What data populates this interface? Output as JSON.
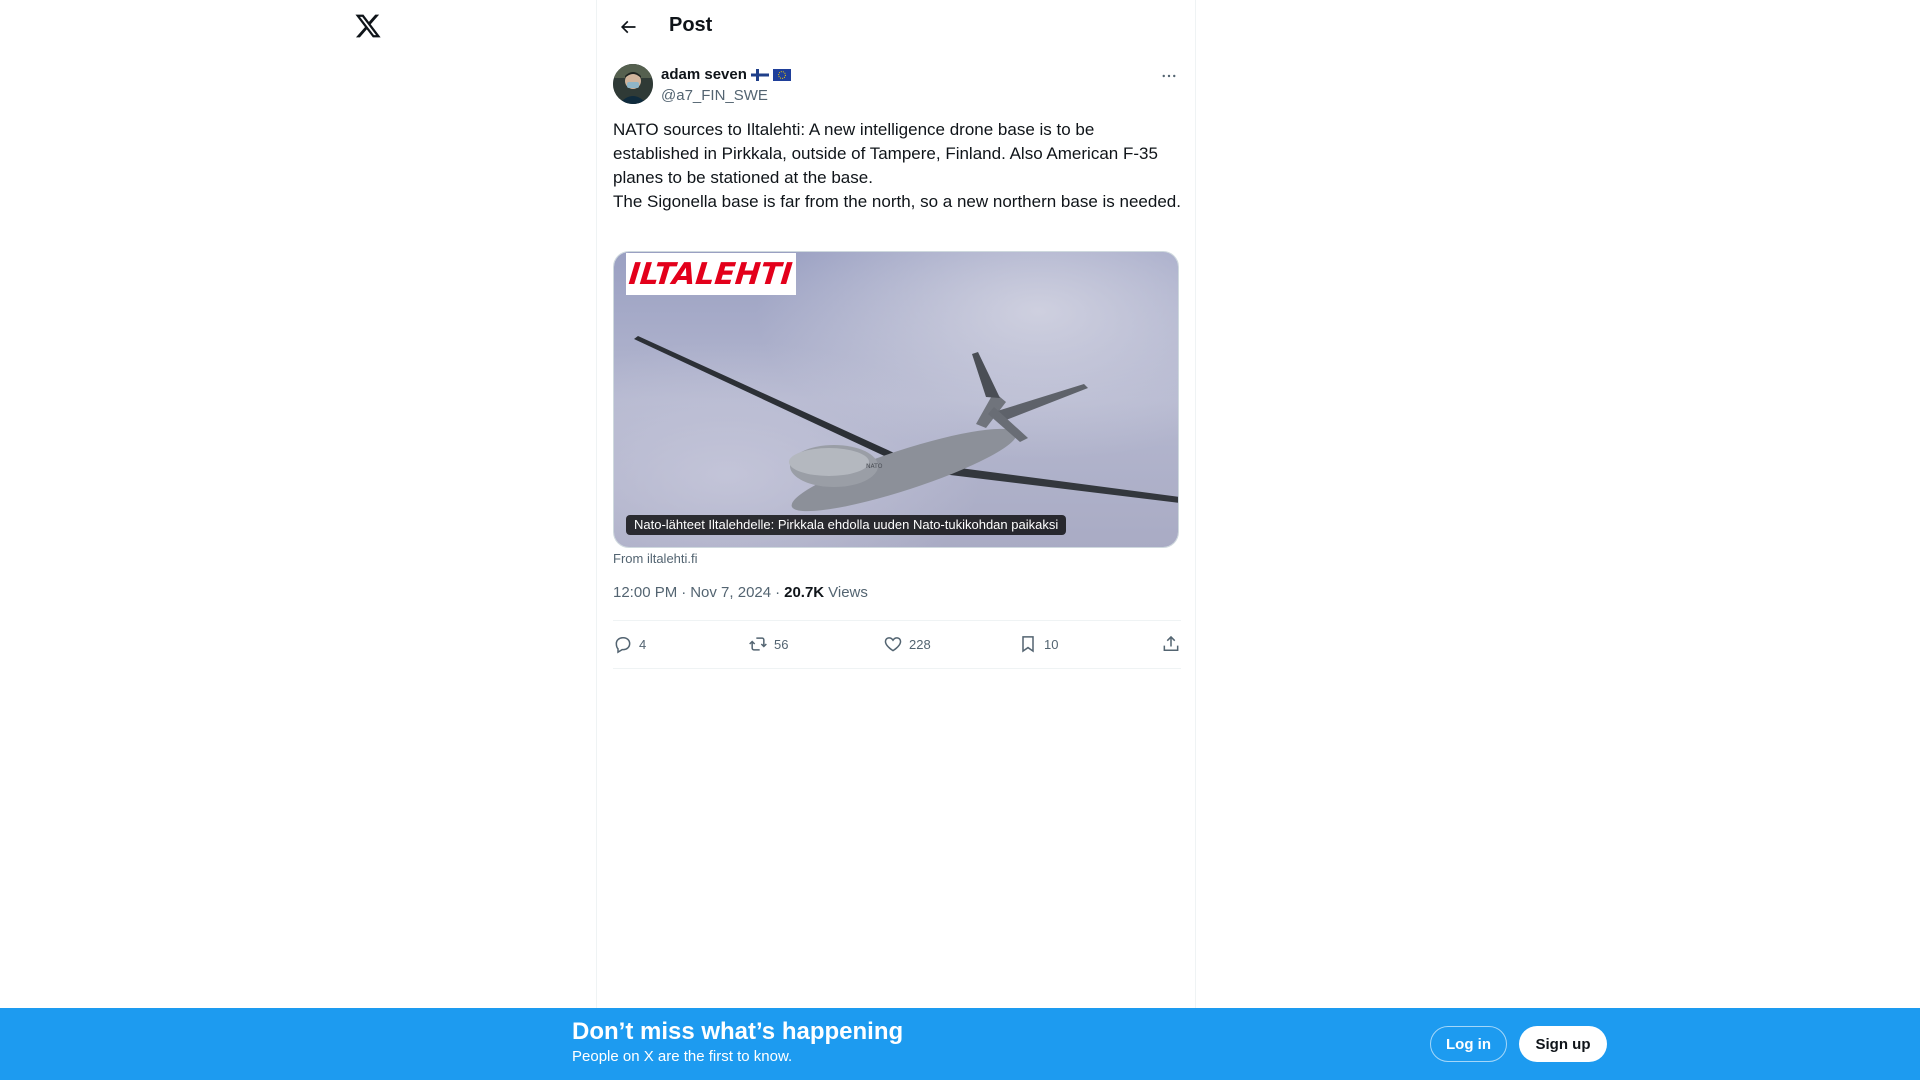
{
  "header": {
    "logo": "x-logo-icon",
    "title": "Post",
    "back_icon": "arrow-left-icon"
  },
  "post": {
    "author_name": "adam seven",
    "author_flags": [
      "finland-flag",
      "eu-flag"
    ],
    "author_handle": "@a7_FIN_SWE",
    "text_lines": [
      "NATO sources to Iltalehti: A new intelligence drone base is to be established in Pirkkala, outside of Tampere, Finland. Also American F-35 planes to be stationed at the base.",
      "The Sigonella base is far from the north, so a new northern base is needed."
    ],
    "card": {
      "logo_text": "ILTALEHTI",
      "caption": "Nato-lähteet Iltalehdelle: Pirkkala ehdolla uuden Nato-tukikohdan paikaksi",
      "source": "From iltalehti.fi"
    },
    "time": "12:00 PM",
    "date": "Nov 7, 2024",
    "views_count": "20.7K",
    "views_label": "Views",
    "separator": "·",
    "stats": {
      "replies": "4",
      "reposts": "56",
      "likes": "228",
      "bookmarks": "10"
    }
  },
  "banner": {
    "title": "Don’t miss what’s happening",
    "subtitle": "People on X are the first to know.",
    "login_label": "Log in",
    "signup_label": "Sign up"
  },
  "colors": {
    "accent": "#1d9bf0",
    "text": "#0f1419",
    "muted": "#536471",
    "brand_red": "#e3001b"
  }
}
